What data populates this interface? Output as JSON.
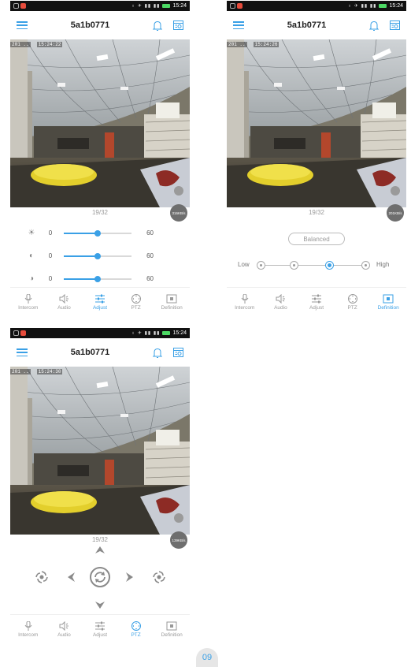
{
  "statusbar": {
    "time": "15:24",
    "icons": "♁ ✈ ▮▮ ▮▮"
  },
  "app": {
    "title": "5a1b0771"
  },
  "screens": [
    {
      "osd_date": "201 ..",
      "osd_time": "15:24:22",
      "page": "19/32",
      "speed": "316KB/s",
      "active_tab": "Adjust",
      "sliders": [
        {
          "icon": "brightness-icon",
          "min": "0",
          "max": "60",
          "value": 0.5
        },
        {
          "icon": "contrast-icon",
          "min": "0",
          "max": "60",
          "value": 0.5
        },
        {
          "icon": "saturation-icon",
          "min": "0",
          "max": "60",
          "value": 0.5
        }
      ]
    },
    {
      "osd_date": "201 ..",
      "osd_time": "15:24:26",
      "page": "19/32",
      "speed": "201KB/s",
      "active_tab": "Definition",
      "mode_label": "Balanced",
      "low_label": "Low",
      "high_label": "High",
      "level_count": 4,
      "selected_level": 3
    },
    {
      "osd_date": "201 ..",
      "osd_time": "15:24:30",
      "page": "19/32",
      "speed": "139KB/s",
      "active_tab": "PTZ"
    }
  ],
  "tabs": [
    {
      "label": "Intercom",
      "icon": "microphone-icon"
    },
    {
      "label": "Audio",
      "icon": "speaker-icon"
    },
    {
      "label": "Adjust",
      "icon": "sliders-icon"
    },
    {
      "label": "PTZ",
      "icon": "ptz-icon"
    },
    {
      "label": "Definition",
      "icon": "definition-icon"
    }
  ],
  "footer": {
    "page_number": "09"
  },
  "colors": {
    "accent": "#3aa0e6",
    "statusbar": "#111111",
    "inactive": "#999999"
  }
}
